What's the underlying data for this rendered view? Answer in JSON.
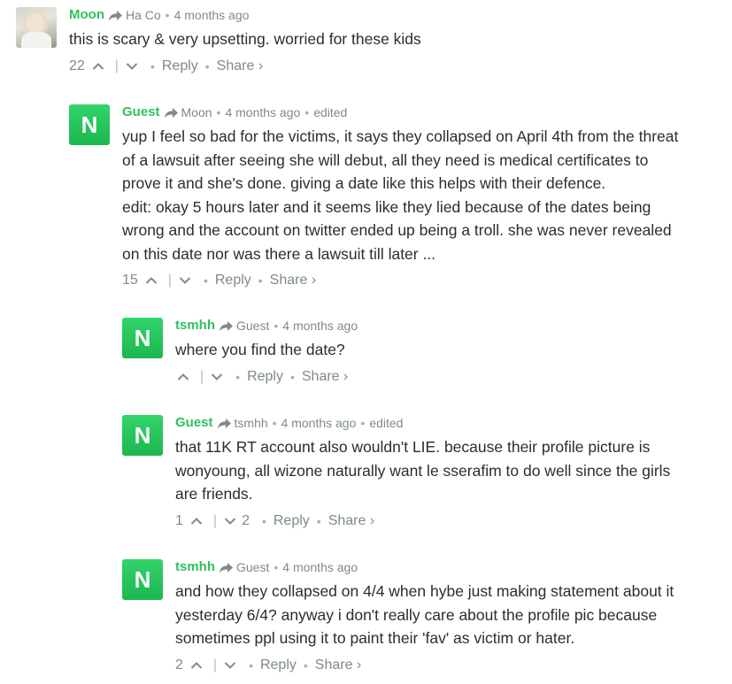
{
  "colors": {
    "author": "#2fc15d",
    "meta": "#7f8a8a",
    "text": "#2a2e2e",
    "avatar_green": "#1cb74e"
  },
  "icons": {
    "reply_arrow": "reply-arrow-icon",
    "upvote": "chevron-up-icon",
    "downvote": "chevron-down-icon"
  },
  "comments": [
    {
      "author": "Moon",
      "parent": "Ha Co",
      "time": "4 months ago",
      "edited": "",
      "avatar": "photo",
      "lines": [
        "this is scary & very upsetting. worried for these kids"
      ],
      "upvotes": "22",
      "downvotes": "",
      "reply": "Reply",
      "share": "Share ›"
    },
    {
      "author": "Guest",
      "parent": "Moon",
      "time": "4 months ago",
      "edited": "edited",
      "avatar": "N",
      "lines": [
        "yup I feel so bad for the victims, it says they collapsed on April 4th from the threat",
        "of a lawsuit after seeing she will debut, all they need is medical certificates to",
        "prove it and she's done. giving a date like this helps with their defence.",
        "edit: okay 5 hours later and it seems like they lied because of the dates being",
        "wrong and the account on twitter ended up being a troll. she was never revealed",
        "on this date nor was there a lawsuit till later ..."
      ],
      "upvotes": "15",
      "downvotes": "",
      "reply": "Reply",
      "share": "Share ›"
    },
    {
      "author": "tsmhh",
      "parent": "Guest",
      "time": "4 months ago",
      "edited": "",
      "avatar": "N",
      "lines": [
        "where you find the date?"
      ],
      "upvotes": "",
      "downvotes": "",
      "reply": "Reply",
      "share": "Share ›"
    },
    {
      "author": "Guest",
      "parent": "tsmhh",
      "time": "4 months ago",
      "edited": "edited",
      "avatar": "N",
      "lines": [
        "that 11K RT account also wouldn't LIE. because their profile picture is",
        "wonyoung, all wizone naturally want le sserafim to do well since the girls",
        "are friends."
      ],
      "upvotes": "1",
      "downvotes": "2",
      "reply": "Reply",
      "share": "Share ›"
    },
    {
      "author": "tsmhh",
      "parent": "Guest",
      "time": "4 months ago",
      "edited": "",
      "avatar": "N",
      "lines": [
        "and how they collapsed on 4/4 when hybe just making statement about it",
        "yesterday 6/4? anyway i don't really care about the profile pic because",
        "sometimes ppl using it to paint their 'fav' as victim or hater."
      ],
      "upvotes": "2",
      "downvotes": "",
      "reply": "Reply",
      "share": "Share ›"
    }
  ]
}
